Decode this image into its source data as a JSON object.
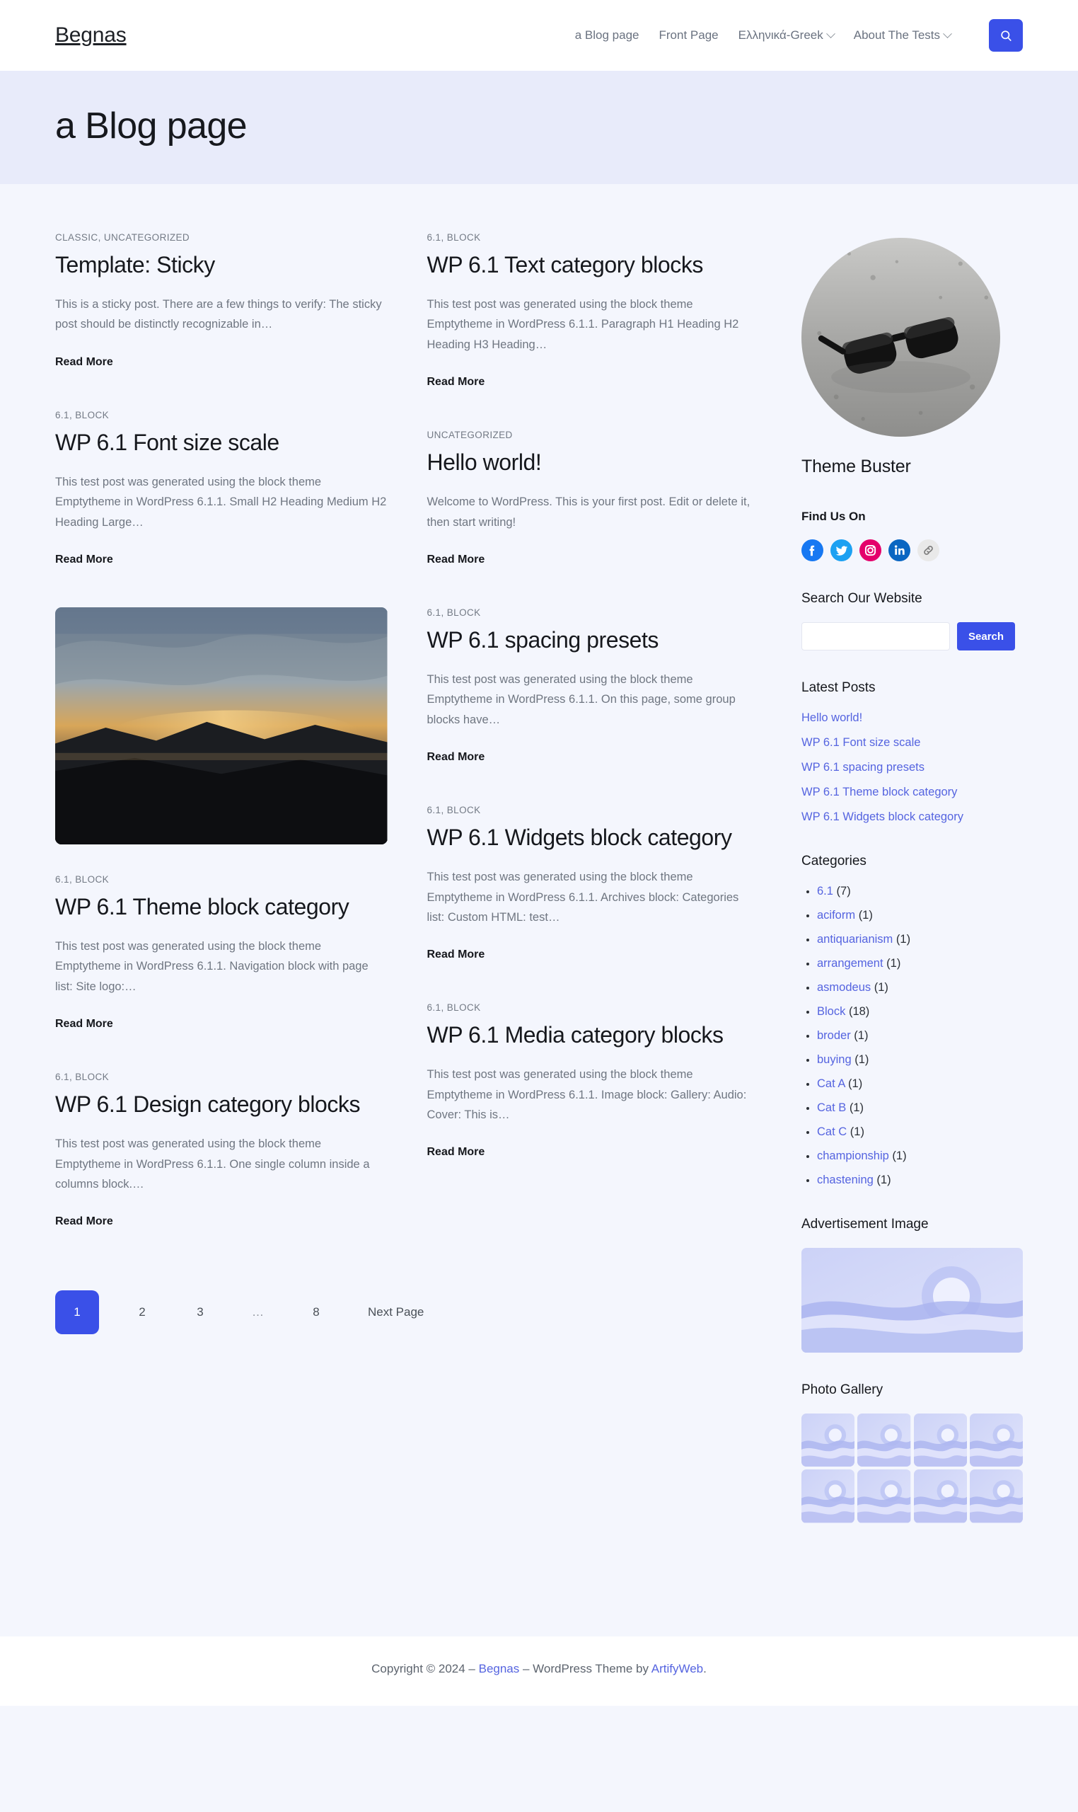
{
  "header": {
    "site_title": "Begnas",
    "nav": [
      {
        "label": "a Blog page",
        "has_submenu": false
      },
      {
        "label": "Front Page",
        "has_submenu": false
      },
      {
        "label": "Ελληνικά-Greek",
        "has_submenu": true
      },
      {
        "label": "About The Tests",
        "has_submenu": true
      }
    ],
    "search_toggle_icon": "search-icon"
  },
  "hero": {
    "title": "a Blog page"
  },
  "posts": [
    {
      "categories": "CLASSIC, UNCATEGORIZED",
      "title": "Template: Sticky",
      "excerpt": "This is a sticky post. There are a few things to verify: The sticky post should be distinctly recognizable in…",
      "read_more": "Read More",
      "has_image": false,
      "column": 1
    },
    {
      "categories": "6.1, BLOCK",
      "title": "WP 6.1 Font size scale",
      "excerpt": "This test post was generated using the block theme Emptytheme in WordPress 6.1.1. Small H2 Heading Medium H2 Heading Large…",
      "read_more": "Read More",
      "has_image": false,
      "column": 1
    },
    {
      "categories": "6.1, BLOCK",
      "title": "WP 6.1 Theme block category",
      "excerpt": "This test post was generated using the block theme Emptytheme in WordPress 6.1.1. Navigation block with page list: Site logo:…",
      "read_more": "Read More",
      "has_image": true,
      "image_alt": "sunset-over-dark-hills-photo",
      "column": 1
    },
    {
      "categories": "6.1, BLOCK",
      "title": "WP 6.1 Design category blocks",
      "excerpt": "This test post was generated using the block theme Emptytheme in WordPress 6.1.1. One single column inside a columns block.…",
      "read_more": "Read More",
      "has_image": false,
      "column": 1
    },
    {
      "categories": "6.1, BLOCK",
      "title": "WP 6.1 Text category blocks",
      "excerpt": "This test post was generated using the block theme Emptytheme in WordPress 6.1.1. Paragraph H1 Heading H2 Heading H3 Heading…",
      "read_more": "Read More",
      "has_image": false,
      "column": 1
    },
    {
      "categories": "UNCATEGORIZED",
      "title": "Hello world!",
      "excerpt": "Welcome to WordPress. This is your first post. Edit or delete it, then start writing!",
      "read_more": "Read More",
      "has_image": false,
      "column": 2
    },
    {
      "categories": "6.1, BLOCK",
      "title": "WP 6.1 spacing presets",
      "excerpt": "This test post was generated using the block theme Emptytheme in WordPress 6.1.1. On this page, some group blocks have…",
      "read_more": "Read More",
      "has_image": false,
      "column": 2
    },
    {
      "categories": "6.1, BLOCK",
      "title": "WP 6.1 Widgets block category",
      "excerpt": "This test post was generated using the block theme Emptytheme in WordPress 6.1.1. Archives block: Categories list: Custom HTML: test…",
      "read_more": "Read More",
      "has_image": false,
      "column": 2
    },
    {
      "categories": "6.1, BLOCK",
      "title": "WP 6.1 Media category blocks",
      "excerpt": "This test post was generated using the block theme Emptytheme in WordPress 6.1.1. Image block: Gallery: Audio: Cover: This is…",
      "read_more": "Read More",
      "has_image": false,
      "column": 2
    }
  ],
  "pagination": {
    "current": "1",
    "pages": [
      "2",
      "3",
      "…",
      "8"
    ],
    "next_label": "Next Page"
  },
  "sidebar": {
    "avatar_alt": "person-wearing-sunglasses-photo",
    "profile_name": "Theme Buster",
    "social": {
      "title": "Find Us On",
      "items": [
        {
          "name": "facebook-icon",
          "color": "#1778f2"
        },
        {
          "name": "twitter-icon",
          "color": "#1da1f2"
        },
        {
          "name": "instagram-icon",
          "color": "#e4006b"
        },
        {
          "name": "linkedin-icon",
          "color": "#0a66c2"
        },
        {
          "name": "link-icon",
          "color": "#e9e9e9"
        }
      ]
    },
    "search": {
      "title": "Search Our Website",
      "value": "",
      "placeholder": "",
      "button_label": "Search"
    },
    "latest_posts": {
      "title": "Latest Posts",
      "items": [
        "Hello world!",
        "WP 6.1 Font size scale",
        "WP 6.1 spacing presets",
        "WP 6.1 Theme block category",
        "WP 6.1 Widgets block category"
      ]
    },
    "categories": {
      "title": "Categories",
      "items": [
        {
          "label": "6.1",
          "count": "(7)"
        },
        {
          "label": "aciform",
          "count": "(1)"
        },
        {
          "label": "antiquarianism",
          "count": "(1)"
        },
        {
          "label": "arrangement",
          "count": "(1)"
        },
        {
          "label": "asmodeus",
          "count": "(1)"
        },
        {
          "label": "Block",
          "count": "(18)"
        },
        {
          "label": "broder",
          "count": "(1)"
        },
        {
          "label": "buying",
          "count": "(1)"
        },
        {
          "label": "Cat A",
          "count": "(1)"
        },
        {
          "label": "Cat B",
          "count": "(1)"
        },
        {
          "label": "Cat C",
          "count": "(1)"
        },
        {
          "label": "championship",
          "count": "(1)"
        },
        {
          "label": "chastening",
          "count": "(1)"
        }
      ]
    },
    "advertisement": {
      "title": "Advertisement Image",
      "image_alt": "placeholder-landscape-image"
    },
    "gallery": {
      "title": "Photo Gallery",
      "count": 8,
      "image_alt": "placeholder-thumbnail"
    }
  },
  "footer": {
    "prefix": "Copyright © 2024 – ",
    "site_link": "Begnas",
    "middle": " – WordPress Theme by ",
    "author_link": "ArtifyWeb",
    "suffix": "."
  },
  "colors": {
    "accent": "#3a50e8",
    "link": "#5564e0",
    "page_bg": "#f4f6fd",
    "hero_bg": "#e8ebfa",
    "header_bg": "#ffffff"
  }
}
